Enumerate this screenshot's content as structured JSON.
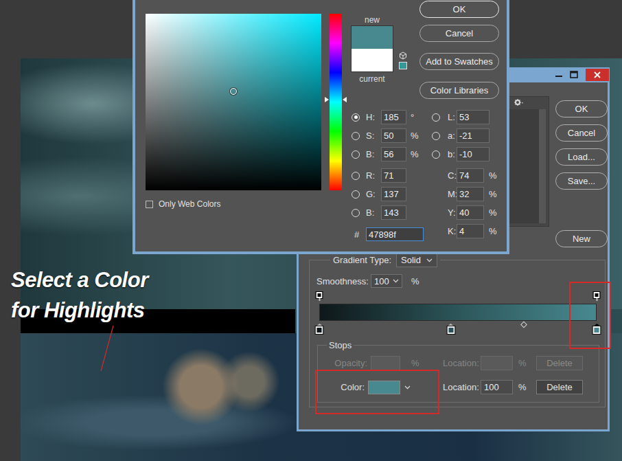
{
  "caption": {
    "lines": [
      "Select a Color",
      "for Highlights"
    ]
  },
  "color_picker": {
    "new_label": "new",
    "current_label": "current",
    "new_color": "#47898f",
    "current_color": "#ffffff",
    "web_safe_color": "#339999",
    "buttons": [
      {
        "label": "OK",
        "default": true
      },
      {
        "label": "Cancel",
        "default": false
      },
      {
        "label": "Add to Swatches",
        "default": false
      },
      {
        "label": "Color Libraries",
        "default": false
      }
    ],
    "hue_level": 0.514,
    "marker": {
      "saturation_level": 0.5,
      "brightness_level": 0.56
    },
    "fields_left": [
      {
        "label": "H:",
        "value": "185",
        "unit": "°",
        "kind": "radio",
        "selected": true
      },
      {
        "label": "S:",
        "value": "50",
        "unit": "%",
        "kind": "radio",
        "selected": false
      },
      {
        "label": "B:",
        "value": "56",
        "unit": "%",
        "kind": "radio",
        "selected": false
      },
      {
        "label": "R:",
        "value": "71",
        "unit": "",
        "kind": "radio",
        "selected": false
      },
      {
        "label": "G:",
        "value": "137",
        "unit": "",
        "kind": "radio",
        "selected": false
      },
      {
        "label": "B:",
        "value": "143",
        "unit": "",
        "kind": "radio",
        "selected": false
      }
    ],
    "fields_right": [
      {
        "label": "L:",
        "value": "53",
        "unit": "",
        "kind": "radio",
        "selected": false
      },
      {
        "label": "a:",
        "value": "-21",
        "unit": "",
        "kind": "radio",
        "selected": false
      },
      {
        "label": "b:",
        "value": "-10",
        "unit": "",
        "kind": "radio",
        "selected": false
      },
      {
        "label": "C:",
        "value": "74",
        "unit": "%",
        "kind": "plain"
      },
      {
        "label": "M:",
        "value": "32",
        "unit": "%",
        "kind": "plain"
      },
      {
        "label": "Y:",
        "value": "40",
        "unit": "%",
        "kind": "plain"
      },
      {
        "label": "K:",
        "value": "4",
        "unit": "%",
        "kind": "plain"
      }
    ],
    "hex": {
      "label": "#",
      "value": "47898f",
      "focused": true
    },
    "only_web_colors": {
      "label": "Only Web Colors",
      "checked": false
    }
  },
  "gradient_editor": {
    "buttons": [
      "OK",
      "Cancel",
      "Load...",
      "Save..."
    ],
    "new_button": "New",
    "gradient_type": {
      "label": "Gradient Type:",
      "value": "Solid"
    },
    "smoothness": {
      "label": "Smoothness:",
      "value": "100",
      "unit": "%"
    },
    "opacity_stops": [
      {
        "level": 0,
        "selected": false
      },
      {
        "level": 1,
        "selected": false
      }
    ],
    "color_stops": [
      {
        "level": 0,
        "color": "#0e1719",
        "selected": false
      },
      {
        "level": 0.475,
        "color": "#2b5357",
        "selected": false
      },
      {
        "level": 1,
        "color": "#47898f",
        "selected": true
      }
    ],
    "midpoint": {
      "level": 0.5
    },
    "stops": {
      "title": "Stops",
      "opacity": {
        "label": "Opacity:",
        "unit": "%",
        "location_label": "Location:",
        "location_unit": "%",
        "delete": "Delete",
        "disabled": true
      },
      "color": {
        "label": "Color:",
        "value": "#47898f",
        "location_label": "Location:",
        "location_value": "100",
        "location_unit": "%",
        "delete": "Delete",
        "disabled": false
      }
    }
  }
}
